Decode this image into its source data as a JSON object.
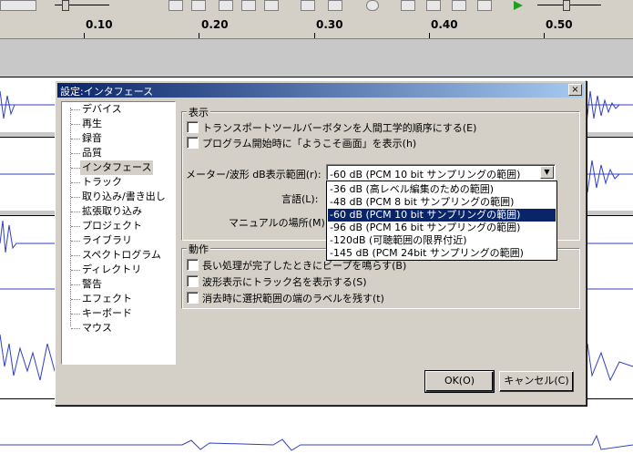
{
  "ruler": {
    "ticks": [
      "0.10",
      "0.20",
      "0.30",
      "0.40",
      "0.50"
    ]
  },
  "dialog": {
    "title": "設定:インタフェース",
    "close_label": "×",
    "nav_items": [
      "デバイス",
      "再生",
      "録音",
      "品質",
      "インタフェース",
      "トラック",
      "取り込み/書き出し",
      "拡張取り込み",
      "プロジェクト",
      "ライブラリ",
      "スペクトログラム",
      "ディレクトリ",
      "警告",
      "エフェクト",
      "キーボード",
      "マウス"
    ],
    "selected_nav": "インタフェース",
    "display_group": {
      "label": "表示",
      "checkboxes": [
        "トランスポートツールバーボタンを人間工学的順序にする(E)",
        "プログラム開始時に「ようこそ画面」を表示(h)"
      ],
      "meter_label": "メーター/波形 dB表示範囲(r):",
      "meter_value": "-60 dB (PCM 10 bit サンプリングの範囲)",
      "language_label": "言語(L):",
      "manual_label": "マニュアルの場所(M):",
      "dropdown_options": [
        "-36 dB (高レベル編集のための範囲)",
        "-48 dB (PCM  8 bit サンプリングの範囲)",
        "-60 dB (PCM 10 bit サンプリングの範囲)",
        "-96 dB (PCM 16 bit サンプリングの範囲)",
        "-120dB (可聴範囲の限界付近)",
        "-145 dB (PCM 24bit サンプリングの範囲)"
      ],
      "dropdown_selected_index": 2
    },
    "behavior_group": {
      "label": "動作",
      "checkboxes": [
        "長い処理が完了したときにビープを鳴らす(B)",
        "波形表示にトラック名を表示する(S)",
        "消去時に選択範囲の端のラベルを残す(t)"
      ]
    },
    "ok_label": "OK(O)",
    "cancel_label": "キャンセル(C)"
  },
  "colors": {
    "title_start": "#0a246a",
    "title_end": "#a6caf0",
    "highlight": "#0a246a",
    "wave": "#3040c0"
  }
}
